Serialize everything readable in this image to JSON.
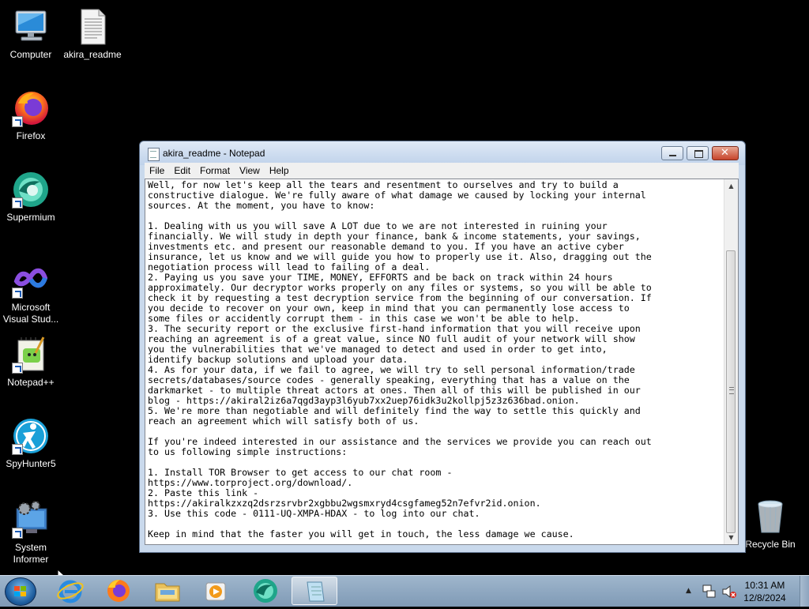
{
  "desktop": {
    "icons": [
      {
        "label": "Computer",
        "icon": "computer-icon"
      },
      {
        "label": "akira_readme",
        "icon": "text-file-icon"
      },
      {
        "label": "Firefox",
        "icon": "firefox-icon"
      },
      {
        "label": "Supermium",
        "icon": "supermium-icon"
      },
      {
        "label": "Microsoft Visual Stud...",
        "icon": "visual-studio-icon"
      },
      {
        "label": "Notepad++",
        "icon": "notepad-plus-plus-icon"
      },
      {
        "label": "SpyHunter5",
        "icon": "spyhunter-icon"
      },
      {
        "label": "System Informer",
        "icon": "system-informer-icon"
      },
      {
        "label": "Recycle Bin",
        "icon": "recycle-bin-icon"
      }
    ]
  },
  "notepad": {
    "title": "akira_readme - Notepad",
    "menu": [
      "File",
      "Edit",
      "Format",
      "View",
      "Help"
    ],
    "content": "Well, for now let's keep all the tears and resentment to ourselves and try to build a\nconstructive dialogue. We're fully aware of what damage we caused by locking your internal\nsources. At the moment, you have to know:\n\n1. Dealing with us you will save A LOT due to we are not interested in ruining your\nfinancially. We will study in depth your finance, bank & income statements, your savings,\ninvestments etc. and present our reasonable demand to you. If you have an active cyber\ninsurance, let us know and we will guide you how to properly use it. Also, dragging out the\nnegotiation process will lead to failing of a deal.\n2. Paying us you save your TIME, MONEY, EFFORTS and be back on track within 24 hours\napproximately. Our decryptor works properly on any files or systems, so you will be able to\ncheck it by requesting a test decryption service from the beginning of our conversation. If\nyou decide to recover on your own, keep in mind that you can permanently lose access to\nsome files or accidently corrupt them - in this case we won't be able to help.\n3. The security report or the exclusive first-hand information that you will receive upon\nreaching an agreement is of a great value, since NO full audit of your network will show\nyou the vulnerabilities that we've managed to detect and used in order to get into,\nidentify backup solutions and upload your data.\n4. As for your data, if we fail to agree, we will try to sell personal information/trade\nsecrets/databases/source codes - generally speaking, everything that has a value on the\ndarkmarket - to multiple threat actors at ones. Then all of this will be published in our\nblog - https://akiral2iz6a7qgd3ayp3l6yub7xx2uep76idk3u2kollpj5z3z636bad.onion.\n5. We're more than negotiable and will definitely find the way to settle this quickly and\nreach an agreement which will satisfy both of us.\n\nIf you're indeed interested in our assistance and the services we provide you can reach out\nto us following simple instructions:\n\n1. Install TOR Browser to get access to our chat room -\nhttps://www.torproject.org/download/.\n2. Paste this link -\nhttps://akiralkzxzq2dsrzsrvbr2xgbbu2wgsmxryd4csgfameg52n7efvr2id.onion.\n3. Use this code - 0111-UQ-XMPA-HDAX - to log into our chat.\n\nKeep in mind that the faster you will get in touch, the less damage we cause."
  },
  "taskbar": {
    "apps": [
      "internet-explorer-icon",
      "firefox-icon",
      "file-explorer-icon",
      "media-player-icon",
      "supermium-icon",
      "notepad-icon"
    ],
    "time": "10:31 AM",
    "date": "12/8/2024"
  }
}
